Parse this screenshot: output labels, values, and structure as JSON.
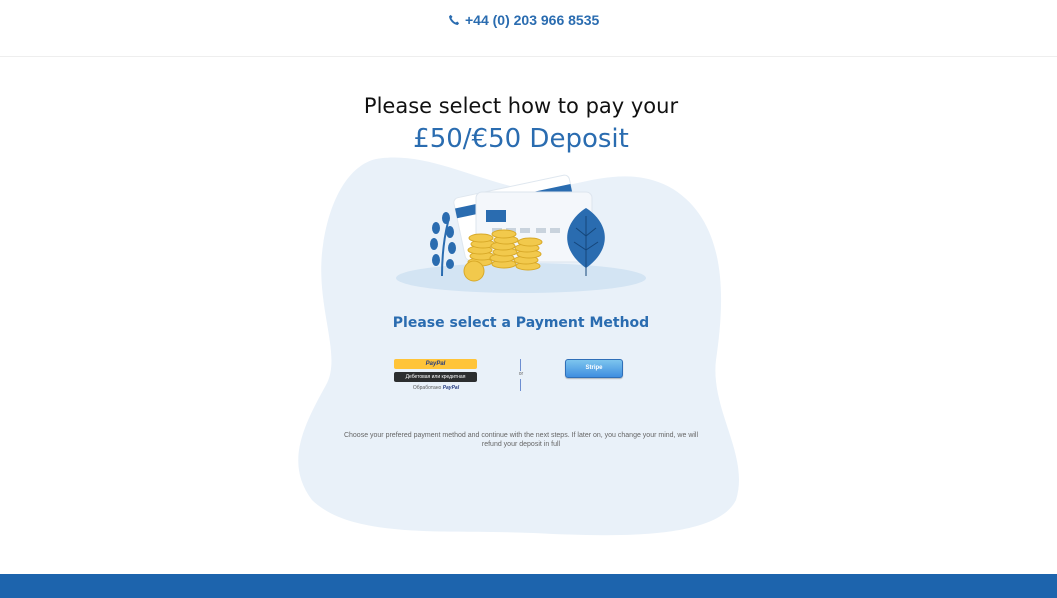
{
  "header": {
    "phone": "+44 (0) 203 966 8535",
    "phone_icon": "phone-icon"
  },
  "main": {
    "title_line1": "Please select how to pay your",
    "title_line2": "£50/€50 Deposit",
    "method_title": "Please select a Payment Method",
    "paypal": {
      "button_label": "PayPal",
      "card_button_label": "Дебетовая или кредитная",
      "powered_prefix": "Обработано",
      "powered_brand": "PayPal"
    },
    "divider_label": "or",
    "stripe_label": "Stripe",
    "note": "Choose your prefered payment method and continue with the next steps. If later on, you change your mind, we will refund your deposit in full"
  },
  "colors": {
    "accent": "#2a6cb0",
    "footer": "#1d64ad",
    "blob": "#e9f1f9",
    "paypal_yellow": "#ffc439",
    "stripe_blue": "#3f8ee0"
  }
}
